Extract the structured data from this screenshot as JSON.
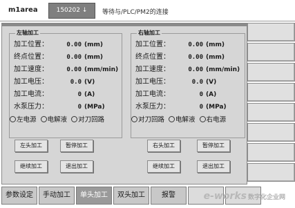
{
  "header": {
    "logo": "m1area",
    "code": "150202 ↓",
    "status": "等待与/PLC/PM2的连接"
  },
  "left_group": {
    "title": "左轴加工",
    "rows": [
      {
        "label": "加工位置：",
        "value": "0.00",
        "unit": "(mm)"
      },
      {
        "label": "终点位置：",
        "value": "0.00",
        "unit": "(mm)"
      },
      {
        "label": "加工速度：",
        "value": "0.00",
        "unit": "(mm/min)"
      },
      {
        "label": "加工电压：",
        "value": "0.0",
        "unit": "(V)"
      },
      {
        "label": "加工电流：",
        "value": "0",
        "unit": "(A)"
      },
      {
        "label": "水泵压力：",
        "value": "0",
        "unit": "(MPa)"
      }
    ],
    "radios": [
      "左电源",
      "电解液",
      "对刀回路"
    ]
  },
  "right_group": {
    "title": "右轴加工",
    "rows": [
      {
        "label": "加工位置：",
        "value": "0.00",
        "unit": "(mm)"
      },
      {
        "label": "终点位置：",
        "value": "0.00",
        "unit": "(mm)"
      },
      {
        "label": "加工速度：",
        "value": "0.00",
        "unit": "(mm/min)"
      },
      {
        "label": "加工电压：",
        "value": "0.0",
        "unit": "(V)"
      },
      {
        "label": "加工电流：",
        "value": "0",
        "unit": "(A)"
      },
      {
        "label": "水泵压力：",
        "value": "0",
        "unit": "(MPa)"
      }
    ],
    "radios": [
      "对刀回路",
      "电解液",
      "右电源"
    ]
  },
  "buttons": {
    "left_start": "左头加工",
    "left_pause": "暂停加工",
    "left_continue": "继续加工",
    "left_exit": "退出加工",
    "right_start": "右头加工",
    "right_pause": "暂停加工",
    "right_continue": "继续加工",
    "right_exit": "退出加工"
  },
  "tabs": [
    "参数设定",
    "手动加工",
    "单头加工",
    "双头加工",
    "报警"
  ],
  "active_tab": "单头加工",
  "watermark": {
    "text": "e-works",
    "cn": "数字化企业网"
  },
  "colors": {
    "panel": "#d6d6d6",
    "active_tab": "#9a9a9a",
    "watermark_accent": "#d77a2a"
  }
}
